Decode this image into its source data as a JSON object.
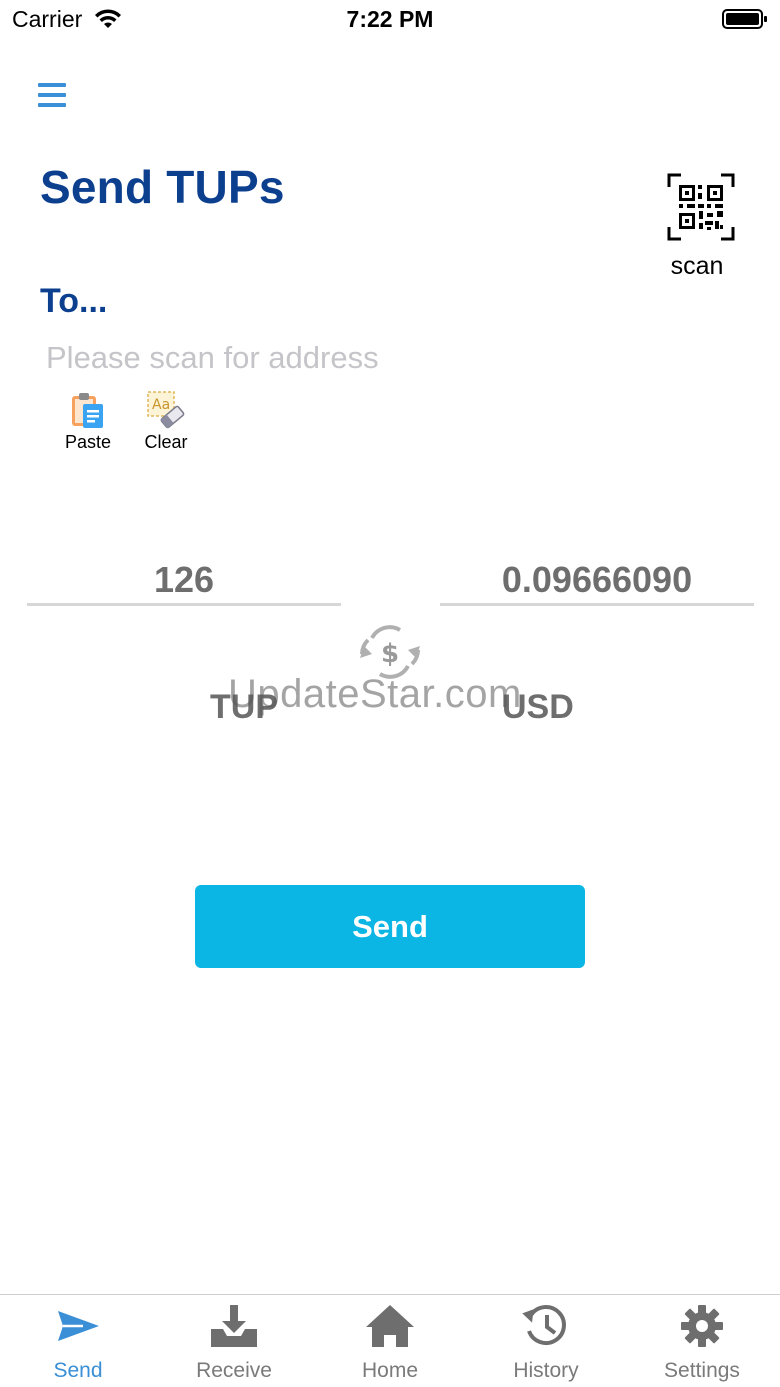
{
  "status_bar": {
    "carrier": "Carrier",
    "time": "7:22 PM"
  },
  "header": {
    "title": "Send TUPs",
    "scan_label": "scan"
  },
  "recipient": {
    "label": "To...",
    "address_value": "",
    "address_placeholder": "Please scan for address",
    "paste_label": "Paste",
    "clear_label": "Clear"
  },
  "amount": {
    "tup_value": "126",
    "usd_value": "0.09666090",
    "tup_currency": "TUP",
    "usd_currency": "USD"
  },
  "watermark": "UpdateStar.com",
  "send_button_label": "Send",
  "tabs": [
    {
      "label": "Send",
      "icon": "paper-plane-icon",
      "active": true
    },
    {
      "label": "Receive",
      "icon": "download-tray-icon",
      "active": false
    },
    {
      "label": "Home",
      "icon": "house-icon",
      "active": false
    },
    {
      "label": "History",
      "icon": "history-clock-icon",
      "active": false
    },
    {
      "label": "Settings",
      "icon": "gear-icon",
      "active": false
    }
  ],
  "colors": {
    "title": "#0d3f8f",
    "accent": "#0bb5e4",
    "tab_active": "#3a8fd6",
    "tab_inactive": "#7a7a7a"
  }
}
